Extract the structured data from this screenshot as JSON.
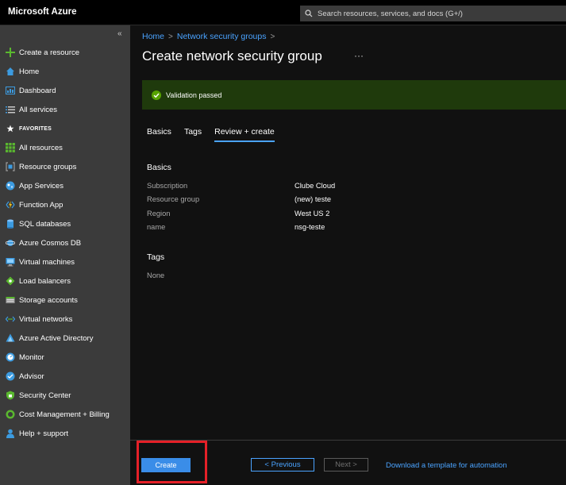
{
  "topbar": {
    "brand": "Microsoft Azure",
    "search_placeholder": "Search resources, services, and docs (G+/)"
  },
  "sidebar": {
    "collapse_glyph": "«",
    "items": [
      {
        "label": "Create a resource",
        "icon": "plus-icon"
      },
      {
        "label": "Home",
        "icon": "home-icon"
      },
      {
        "label": "Dashboard",
        "icon": "dashboard-icon"
      },
      {
        "label": "All services",
        "icon": "list-icon"
      }
    ],
    "favorites_label": "FAVORITES",
    "favorites": [
      {
        "label": "All resources",
        "icon": "grid-icon"
      },
      {
        "label": "Resource groups",
        "icon": "resource-group-icon"
      },
      {
        "label": "App Services",
        "icon": "app-services-icon"
      },
      {
        "label": "Function App",
        "icon": "function-app-icon"
      },
      {
        "label": "SQL databases",
        "icon": "sql-database-icon"
      },
      {
        "label": "Azure Cosmos DB",
        "icon": "cosmos-db-icon"
      },
      {
        "label": "Virtual machines",
        "icon": "virtual-machine-icon"
      },
      {
        "label": "Load balancers",
        "icon": "load-balancer-icon"
      },
      {
        "label": "Storage accounts",
        "icon": "storage-icon"
      },
      {
        "label": "Virtual networks",
        "icon": "virtual-network-icon"
      },
      {
        "label": "Azure Active Directory",
        "icon": "active-directory-icon"
      },
      {
        "label": "Monitor",
        "icon": "monitor-icon"
      },
      {
        "label": "Advisor",
        "icon": "advisor-icon"
      },
      {
        "label": "Security Center",
        "icon": "security-center-icon"
      },
      {
        "label": "Cost Management + Billing",
        "icon": "cost-management-icon"
      },
      {
        "label": "Help + support",
        "icon": "help-support-icon"
      }
    ]
  },
  "main": {
    "breadcrumb": [
      "Home",
      "Network security groups"
    ],
    "title": "Create network security group",
    "more": "···",
    "validation": "Validation passed",
    "tabs": [
      "Basics",
      "Tags",
      "Review + create"
    ],
    "active_tab": "Review + create",
    "basics_title": "Basics",
    "basics": [
      {
        "key": "Subscription",
        "value": "Clube Cloud"
      },
      {
        "key": "Resource group",
        "value": "(new) teste"
      },
      {
        "key": "Region",
        "value": "West US 2"
      },
      {
        "key": "name",
        "value": "nsg-teste"
      }
    ],
    "tags_title": "Tags",
    "tags_value": "None"
  },
  "footer": {
    "create": "Create",
    "previous": "< Previous",
    "next": "Next >",
    "download": "Download a template for automation"
  },
  "colors": {
    "accent": "#4aa3ff",
    "create_button": "#3a8de8",
    "success_banner": "#1f3a0c",
    "success_icon": "#57a300",
    "highlight_box": "#e52028"
  }
}
